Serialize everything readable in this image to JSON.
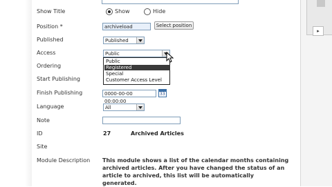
{
  "form": {
    "show_title": {
      "label": "Show Title",
      "options": [
        "Show",
        "Hide"
      ],
      "selected": "Show"
    },
    "position": {
      "label": "Position *",
      "value": "archiveload",
      "button": "Select position"
    },
    "published": {
      "label": "Published",
      "value": "Published"
    },
    "access": {
      "label": "Access",
      "value": "Public",
      "options": [
        "Public",
        "Registered",
        "Special",
        "Customer Access Level"
      ],
      "highlighted": "Registered"
    },
    "ordering": {
      "label": "Ordering"
    },
    "start_publishing": {
      "label": "Start Publishing"
    },
    "finish_publishing": {
      "label": "Finish Publishing",
      "value": "0000-00-00 00:00:00",
      "calendar_text": "33"
    },
    "language": {
      "label": "Language",
      "value": "All"
    },
    "note": {
      "label": "Note",
      "value": ""
    },
    "id": {
      "label": "ID",
      "value": "27",
      "module_name": "Archived Articles"
    },
    "site": {
      "label": "Site"
    },
    "module_description": {
      "label": "Module Description",
      "text": "This module shows a list of the calendar months containing archived articles. After you have changed the status of an article to archived, this list will be automatically generated."
    }
  },
  "sidebar": {
    "button": "▸"
  },
  "colors": {
    "input_border": "#7f9db9",
    "selected_option": "#3a3a3a",
    "calendar_blue": "#3a6ea5"
  }
}
